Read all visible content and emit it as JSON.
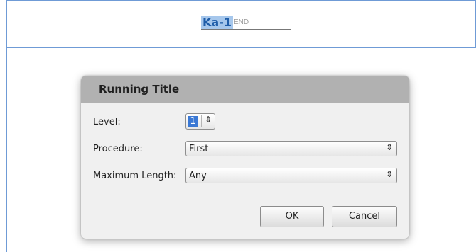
{
  "document": {
    "header_token": "Ka-1",
    "end_marker": "END"
  },
  "dialog": {
    "title": "Running Title",
    "level": {
      "label": "Level:",
      "value": "1"
    },
    "procedure": {
      "label": "Procedure:",
      "value": "First"
    },
    "max_length": {
      "label": "Maximum Length:",
      "value": "Any"
    },
    "ok_label": "OK",
    "cancel_label": "Cancel"
  },
  "icons": {
    "spin_arrows": "up-down-arrow-icon",
    "combo_arrows": "up-down-arrow-icon"
  },
  "colors": {
    "frame": "#6f9bd6",
    "highlight": "#a6c7ec",
    "token_text": "#1f5da8",
    "titlebar": "#b1b1b1",
    "dialog_bg": "#f0f0f0"
  }
}
